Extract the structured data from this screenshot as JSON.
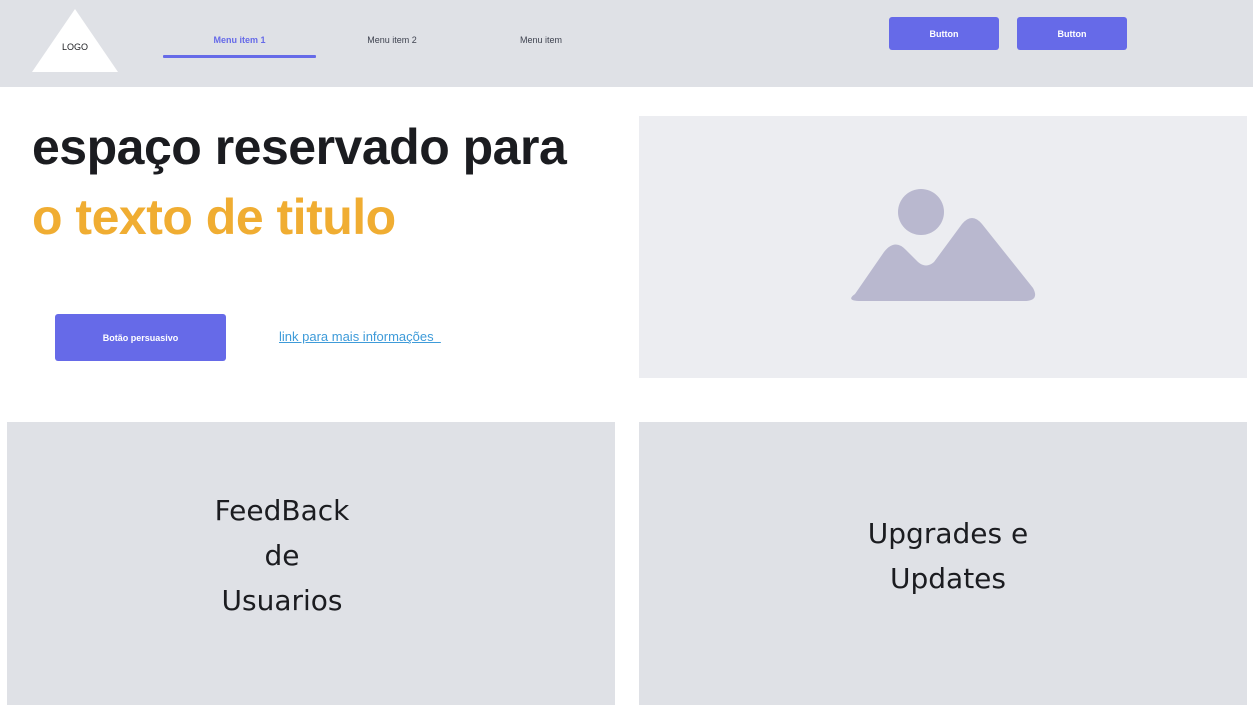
{
  "header": {
    "logo_text": "LOGO",
    "nav": [
      {
        "label": "Menu item 1",
        "active": true
      },
      {
        "label": "Menu item 2",
        "active": false
      },
      {
        "label": "Menu item",
        "active": false
      }
    ],
    "buttons": [
      "Button",
      "Button"
    ]
  },
  "hero": {
    "title_line1": "espaço reservado para",
    "title_line2": "o texto de titulo",
    "cta_label": "Botão persuasivo",
    "link_label": "link para mais informações  ",
    "image_icon": "image-placeholder-icon"
  },
  "cards": [
    {
      "text": "FeedBack\nde\nUsuarios"
    },
    {
      "text": "Upgrades e\nUpdates"
    }
  ],
  "colors": {
    "accent": "#666ae8",
    "title_highlight": "#f0ad32",
    "link": "#3e9bd9",
    "header_bg": "#dfe1e6",
    "card_bg": "#dfe1e6",
    "image_bg": "#ecedf1",
    "image_icon": "#b9b8cf"
  }
}
